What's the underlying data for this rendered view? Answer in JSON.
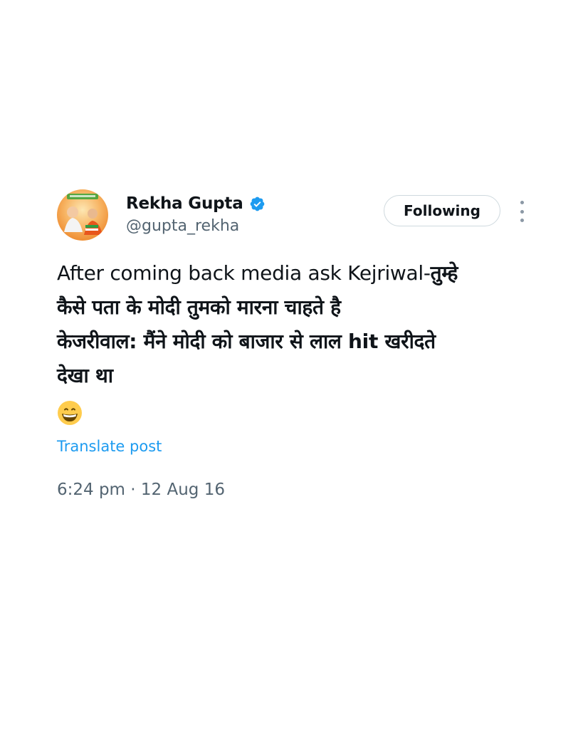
{
  "post": {
    "author": {
      "display_name": "Rekha Gupta",
      "handle": "@gupta_rekha",
      "verified": true,
      "verified_color": "#1d9bf0",
      "avatar_icon": "profile-photo-icon"
    },
    "follow_button_label": "Following",
    "more_icon": "more-vertical-icon",
    "text_lines": [
      {
        "latin": "After coming back media ask Kejriwal-",
        "hindi": "तुम्हे"
      },
      {
        "latin": "",
        "hindi": "कैसे पता के मोदी तुमको मारना चाहते है"
      },
      {
        "latin": "",
        "hindi": "केजरीवाल: मैंने मोदी को बाजार से लाल hit खरीदते"
      },
      {
        "latin": "",
        "hindi": "देखा था"
      }
    ],
    "emoji": "grinning-face-icon",
    "translate_label": "Translate post",
    "timestamp": "6:24 pm · 12 Aug 16"
  },
  "colors": {
    "link": "#1d9bf0",
    "secondary_text": "#536471",
    "primary_text": "#0f1419"
  }
}
